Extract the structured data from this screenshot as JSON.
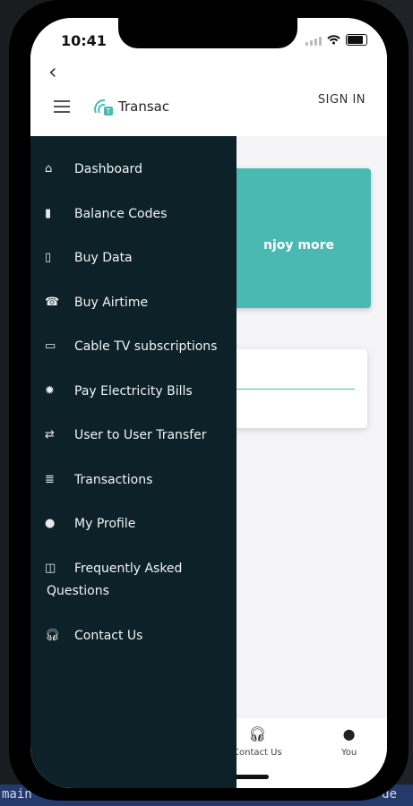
{
  "status_bar": {
    "time": "10:41"
  },
  "header": {
    "brand": "Transac",
    "signin": "SIGN IN"
  },
  "card": {
    "text": "njoy more"
  },
  "drawer": {
    "items": [
      {
        "label": "Dashboard",
        "icon": "home-icon"
      },
      {
        "label": "Balance Codes",
        "icon": "balance-icon"
      },
      {
        "label": "Buy Data",
        "icon": "phone-icon"
      },
      {
        "label": "Buy Airtime",
        "icon": "call-icon"
      },
      {
        "label": "Cable TV subscriptions",
        "icon": "tv-icon"
      },
      {
        "label": "Pay Electricity Bills",
        "icon": "bulb-icon"
      },
      {
        "label": "User to User Transfer",
        "icon": "transfer-icon"
      },
      {
        "label": "Transactions",
        "icon": "list-icon"
      },
      {
        "label": "My Profile",
        "icon": "user-icon"
      },
      {
        "label": "Frequently Asked",
        "label2": "Questions",
        "icon": "faq-icon"
      },
      {
        "label": "Contact Us",
        "icon": "headset-icon"
      }
    ]
  },
  "bottom_nav": [
    {
      "label": "Contact Us",
      "icon": "headset-icon"
    },
    {
      "label": "You",
      "icon": "user-icon"
    }
  ],
  "ide": {
    "left_status": "main",
    "right_status": "de"
  },
  "colors": {
    "drawer_bg": "#0c2128",
    "accent": "#4ab9b1"
  }
}
